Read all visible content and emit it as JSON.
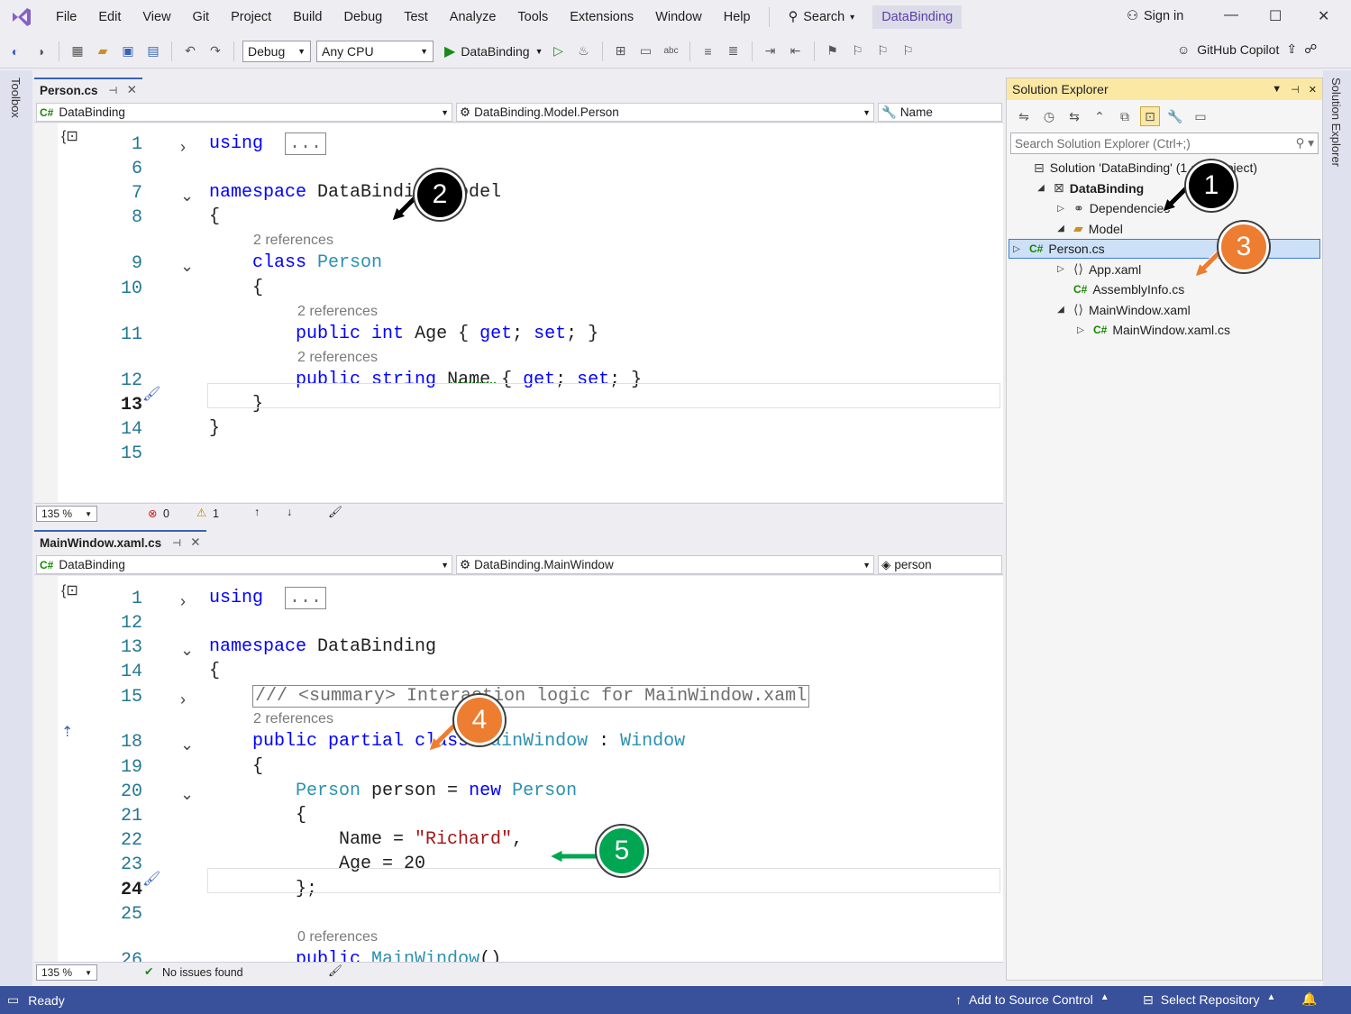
{
  "menu": {
    "items": [
      "File",
      "Edit",
      "View",
      "Git",
      "Project",
      "Build",
      "Debug",
      "Test",
      "Analyze",
      "Tools",
      "Extensions",
      "Window",
      "Help"
    ],
    "search_label": "Search",
    "solution_name": "DataBinding",
    "sign_in": "Sign in"
  },
  "toolbar": {
    "config": "Debug",
    "platform": "Any CPU",
    "run_target": "DataBinding",
    "copilot": "GitHub Copilot"
  },
  "side_strips": {
    "left": "Toolbox",
    "right": "Solution Explorer"
  },
  "editor1": {
    "tab": "Person.cs",
    "nav_project": "DataBinding",
    "nav_type": "DataBinding.Model.Person",
    "nav_member": "Name",
    "zoom": "135 %",
    "errors": "0",
    "warnings": "1",
    "lines": [
      {
        "num": "1",
        "fold": "›",
        "code": [
          [
            "kw",
            "using"
          ],
          [
            "",
            "  "
          ],
          [
            "cm",
            "..."
          ]
        ]
      },
      {
        "num": "6",
        "code": []
      },
      {
        "num": "7",
        "fold": "⌄",
        "code": [
          [
            "kw",
            "namespace"
          ],
          [
            "",
            " DataBinding.Model"
          ]
        ]
      },
      {
        "num": "8",
        "code": [
          [
            "",
            "{"
          ]
        ]
      },
      {
        "lens": "2 references",
        "num": "9",
        "fold": "⌄",
        "code": [
          [
            "",
            "    "
          ],
          [
            "kw",
            "class"
          ],
          [
            "",
            " "
          ],
          [
            "ty",
            "Person"
          ]
        ]
      },
      {
        "num": "10",
        "code": [
          [
            "",
            "    {"
          ]
        ]
      },
      {
        "lens": "2 references",
        "num": "11",
        "code": [
          [
            "",
            "        "
          ],
          [
            "kw",
            "public"
          ],
          [
            "",
            " "
          ],
          [
            "kw",
            "int"
          ],
          [
            "",
            " Age { "
          ],
          [
            "kw",
            "get"
          ],
          [
            "",
            "; "
          ],
          [
            "kw",
            "set"
          ],
          [
            "",
            "; }"
          ]
        ]
      },
      {
        "lens": "2 references",
        "num": "12",
        "code": [
          [
            "",
            "        "
          ],
          [
            "kw",
            "public"
          ],
          [
            "",
            " "
          ],
          [
            "kw",
            "string"
          ],
          [
            "",
            " Name { "
          ],
          [
            "kw",
            "get"
          ],
          [
            "",
            "; "
          ],
          [
            "kw",
            "set"
          ],
          [
            "",
            "; }"
          ]
        ]
      },
      {
        "num": "13",
        "cur": true,
        "code": [
          [
            "",
            "    }"
          ]
        ]
      },
      {
        "num": "14",
        "code": [
          [
            "",
            "}"
          ]
        ]
      },
      {
        "num": "15",
        "code": []
      }
    ]
  },
  "editor2": {
    "tab": "MainWindow.xaml.cs",
    "nav_project": "DataBinding",
    "nav_type": "DataBinding.MainWindow",
    "nav_member": "person",
    "zoom": "135 %",
    "issues": "No issues found",
    "lines": [
      {
        "num": "1",
        "fold": "›",
        "code": [
          [
            "kw",
            "using"
          ],
          [
            "",
            "  "
          ],
          [
            "cm",
            "..."
          ]
        ]
      },
      {
        "num": "12",
        "code": []
      },
      {
        "num": "13",
        "fold": "⌄",
        "code": [
          [
            "kw",
            "namespace"
          ],
          [
            "",
            " DataBinding"
          ]
        ]
      },
      {
        "num": "14",
        "code": [
          [
            "",
            "{"
          ]
        ]
      },
      {
        "num": "15",
        "fold": "›",
        "code": [
          [
            "",
            "    "
          ],
          [
            "cm",
            "/// <summary> Interaction logic for MainWindow.xaml"
          ]
        ]
      },
      {
        "lens": "2 references",
        "num": "18",
        "fold": "⌄",
        "code": [
          [
            "",
            "    "
          ],
          [
            "kw",
            "public"
          ],
          [
            "",
            " "
          ],
          [
            "kw",
            "partial"
          ],
          [
            "",
            " "
          ],
          [
            "kw",
            "class"
          ],
          [
            "",
            " "
          ],
          [
            "ty",
            "MainWindow"
          ],
          [
            "",
            " : "
          ],
          [
            "ty",
            "Window"
          ]
        ]
      },
      {
        "num": "19",
        "code": [
          [
            "",
            "    {"
          ]
        ]
      },
      {
        "num": "20",
        "fold": "⌄",
        "code": [
          [
            "",
            "        "
          ],
          [
            "ty",
            "Person"
          ],
          [
            "",
            " person = "
          ],
          [
            "kw",
            "new"
          ],
          [
            "",
            " "
          ],
          [
            "ty",
            "Person"
          ]
        ]
      },
      {
        "num": "21",
        "code": [
          [
            "",
            "        {"
          ]
        ]
      },
      {
        "num": "22",
        "code": [
          [
            "",
            "            Name = "
          ],
          [
            "str",
            "\"Richard\""
          ],
          [
            "",
            ","
          ]
        ]
      },
      {
        "num": "23",
        "code": [
          [
            "",
            "            Age = 20"
          ]
        ]
      },
      {
        "num": "24",
        "cur": true,
        "code": [
          [
            "",
            "        };"
          ]
        ]
      },
      {
        "num": "25",
        "code": []
      },
      {
        "lens": "0 references",
        "num": "26",
        "fold": "⌄",
        "code": [
          [
            "",
            "        "
          ],
          [
            "kw",
            "public"
          ],
          [
            "",
            " "
          ],
          [
            "ty",
            "MainWindow"
          ],
          [
            "",
            "()"
          ]
        ]
      }
    ]
  },
  "solution_explorer": {
    "title": "Solution Explorer",
    "search_placeholder": "Search Solution Explorer (Ctrl+;)",
    "nodes": [
      {
        "label": "Solution 'DataBinding' (1 of 1 project)",
        "indent": 0,
        "icon": "solution-icon"
      },
      {
        "label": "DataBinding",
        "indent": 1,
        "exp": "◢",
        "icon": "csproj-icon",
        "bold": true
      },
      {
        "label": "Dependencies",
        "indent": 2,
        "exp": "▷",
        "icon": "dependencies-icon"
      },
      {
        "label": "Model",
        "indent": 2,
        "exp": "◢",
        "icon": "folder-icon"
      },
      {
        "label": "Person.cs",
        "indent": 3,
        "exp": "▷",
        "icon": "cs",
        "sel": true
      },
      {
        "label": "App.xaml",
        "indent": 2,
        "exp": "▷",
        "icon": "xaml-icon"
      },
      {
        "label": "AssemblyInfo.cs",
        "indent": 2,
        "icon": "cs"
      },
      {
        "label": "MainWindow.xaml",
        "indent": 2,
        "exp": "◢",
        "icon": "xaml-icon"
      },
      {
        "label": "MainWindow.xaml.cs",
        "indent": 3,
        "exp": "▷",
        "icon": "cs"
      }
    ]
  },
  "status": {
    "ready": "Ready",
    "source_control": "Add to Source Control",
    "repo": "Select Repository"
  },
  "callouts": [
    {
      "n": "1",
      "color": "#000000"
    },
    {
      "n": "2",
      "color": "#000000"
    },
    {
      "n": "3",
      "color": "#ed7d31"
    },
    {
      "n": "4",
      "color": "#ed7d31"
    },
    {
      "n": "5",
      "color": "#00a651"
    }
  ]
}
